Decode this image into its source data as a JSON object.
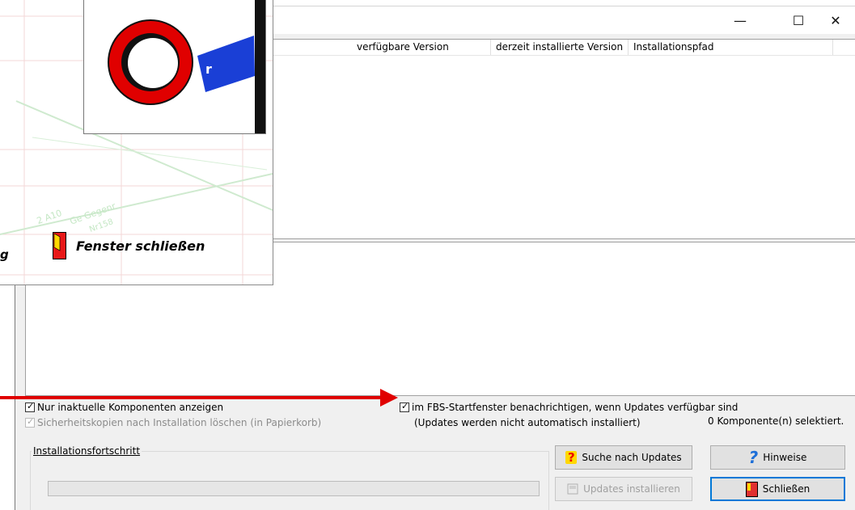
{
  "window": {
    "minimize_glyph": "—",
    "maximize_glyph": "☐",
    "close_glyph": "✕"
  },
  "list": {
    "columns": [
      {
        "label": "verfügbare Version"
      },
      {
        "label": "derzeit installierte Version"
      },
      {
        "label": "Installationspfad"
      }
    ]
  },
  "options": {
    "only_outdated": {
      "label": "Nur inaktuelle Komponenten anzeigen",
      "checked": true
    },
    "delete_backups": {
      "label": "Sicherheitskopien nach Installation löschen (in Papierkorb)",
      "checked": true,
      "disabled": true
    },
    "notify_startwindow": {
      "label": "im FBS-Startfenster benachrichtigen, wenn Updates verfügbar sind",
      "checked": true
    },
    "note": "(Updates werden nicht automatisch installiert)",
    "selected_count": "0 Komponente(n) selektiert."
  },
  "progress": {
    "group_label": "Installationsfortschritt",
    "value": 0
  },
  "buttons": {
    "search_updates": "Suche nach Updates",
    "hints": "Hinweise",
    "install_updates": "Updates installieren",
    "close": "Schließen"
  },
  "overlay": {
    "close_window_label": "Fenster schließen",
    "edge_fragment": "g",
    "map_labels": [
      "2 A10",
      "Ge Gegenr",
      "Nr158"
    ]
  },
  "colors": {
    "arrow": "#e00000",
    "accent": "#0078d7",
    "sign_red": "#e00000",
    "sign_blue": "#1a3fd6"
  }
}
